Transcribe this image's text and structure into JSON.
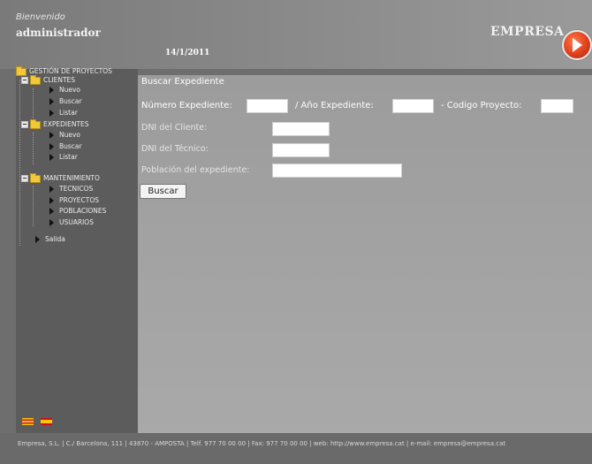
{
  "header": {
    "welcome": "Bienvenido",
    "username": "administrador",
    "date": "14/1/2011",
    "brand": "EMPRESA",
    "brand_logo_icon": "arrow-circle-icon"
  },
  "sidebar": {
    "root": "GESTIÓN DE PROYECTOS",
    "clientes": {
      "label": "CLIENTES",
      "items": [
        "Nuevo",
        "Buscar",
        "Listar"
      ]
    },
    "expedientes": {
      "label": "EXPEDIENTES",
      "items": [
        "Nuevo",
        "Buscar",
        "Listar"
      ]
    },
    "mantenimiento": {
      "label": "MANTENIMIENTO",
      "items": [
        "TECNICOS",
        "PROYECTOS",
        "POBLACIONES",
        "USUARIOS"
      ]
    },
    "salida": "Salida",
    "flags": [
      "catalan-flag-icon",
      "spanish-flag-icon"
    ]
  },
  "form": {
    "title": "Buscar Expediente",
    "numero_label": "Número Expediente:",
    "anio_label": "/ Año Expediente:",
    "codigo_label": "- Codigo Proyecto:",
    "dni_cliente_label": "DNI del Cliente:",
    "dni_tecnico_label": "DNI del Técnico:",
    "poblacion_label": "Población del expediente:",
    "numero_value": "",
    "anio_value": "",
    "codigo_value": "",
    "dni_cliente_value": "",
    "dni_tecnico_value": "",
    "poblacion_value": "",
    "submit_label": "Buscar"
  },
  "footer": {
    "text": "Empresa, S.L. | C./ Barcelona, 111 | 43870 - AMPOSTA | Telf. 977 70 00 00 | Fax: 977 70 00 00 | web: http://www.empresa.cat | e-mail: empresa@empresa.cat"
  }
}
